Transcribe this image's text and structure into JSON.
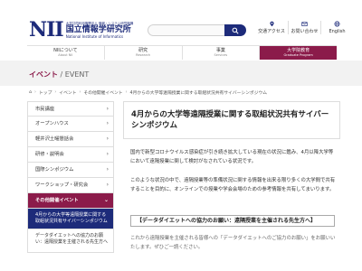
{
  "header": {
    "logo_mark": "NII",
    "logo_sub": "大学共同利用機関法人 情報・システム研究機構",
    "logo_name": "国立情報学研究所",
    "logo_en": "National Institute of Informatics",
    "links": [
      {
        "label": "交通アクセス",
        "icon": "map-pin-icon"
      },
      {
        "label": "お問い合わせ",
        "icon": "mail-icon"
      },
      {
        "label": "English",
        "icon": "globe-icon"
      }
    ]
  },
  "nav": [
    {
      "jp": "NIIについて",
      "en": "About NII"
    },
    {
      "jp": "研究",
      "en": "Research"
    },
    {
      "jp": "事業",
      "en": "Services"
    },
    {
      "jp": "大学院教育",
      "en": "Graduate Program"
    }
  ],
  "banner": {
    "title_jp": "イベント",
    "title_en": "/ EVENT"
  },
  "breadcrumb": [
    "トップ",
    "イベント",
    "その他開催イベント",
    "4月からの大学等遠隔授業に関する取組状況共有サイバーシンポジウム"
  ],
  "sidebar": {
    "items": [
      "市民講座",
      "オープンハウス",
      "軽井沢土曜懇話会",
      "研修・説明会",
      "国際シンポジウム",
      "ワークショップ・研究会"
    ],
    "active": "その他開催イベント",
    "sub_current": "4月からの大学等遠隔授業に関する取組状況共有サイバーシンポジウム",
    "sub_next": "データダイエットへの協力のお願い：遠隔授業を主催される先生方へ"
  },
  "main": {
    "title": "4月からの大学等遠隔授業に関する取組状況共有サイバーシンポジウム",
    "para1": "国内で新型コロナウイルス感染症が引き続き拡大している現在の状況に鑑み、4月以降大学等において遠隔授業に関して検討がなされている状況です。",
    "para2": "このような状況の中で、遠隔授業等の準備状況に関する情報を出来る限り多くの大学間で共有することを目的に、オンラインでの授業や学会会場のための参考情報を共有してまいります。",
    "section": "【データダイエットへの協力のお願い：遠隔授業を主催される先生方へ】",
    "para3": "これから遠隔授業を主催される皆様への「データダイエットへのご協力のお願い」をお願いいたします。ぜひご一読ください。"
  }
}
